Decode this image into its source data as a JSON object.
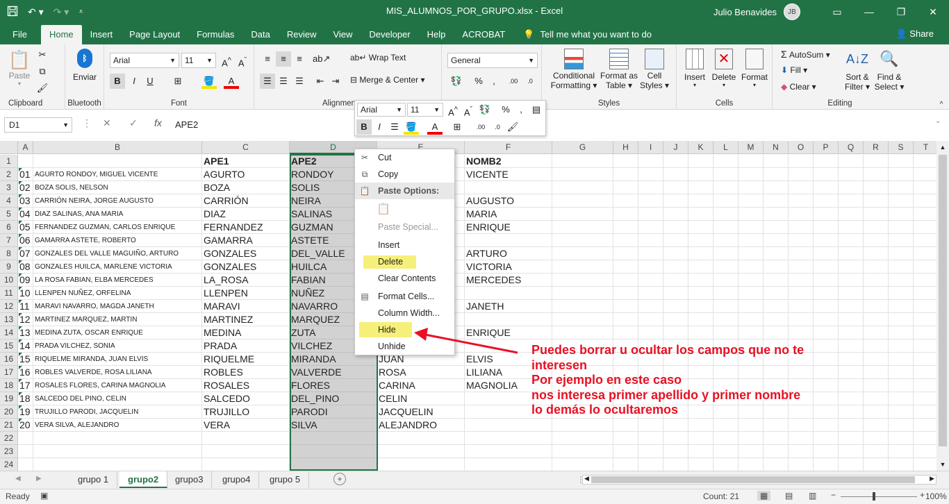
{
  "title_bar": {
    "title": "MIS_ALUMNOS_POR_GRUPO.xlsx  -  Excel",
    "user": "Julio Benavides",
    "avatar": "JB"
  },
  "menu": {
    "items": [
      "File",
      "Home",
      "Insert",
      "Page Layout",
      "Formulas",
      "Data",
      "Review",
      "View",
      "Developer",
      "Help",
      "ACROBAT"
    ],
    "tell": "Tell me what you want to do",
    "share": "Share"
  },
  "ribbon": {
    "clipboard": {
      "label": "Clipboard",
      "paste": "Paste"
    },
    "bluetooth": {
      "label": "Bluetooth",
      "enviar": "Enviar"
    },
    "font": {
      "label": "Font",
      "family": "Arial",
      "size": "11",
      "bold": "B",
      "italic": "I",
      "underline": "U"
    },
    "alignment": {
      "label": "Alignment",
      "wrap": "Wrap Text",
      "merge": "Merge & Center"
    },
    "number": {
      "format": "General",
      "percent": "%",
      "comma": ","
    },
    "styles": {
      "label": "Styles",
      "conditional_1": "Conditional",
      "conditional_2": "Formatting",
      "format_table_1": "Format as",
      "format_table_2": "Table",
      "cell_styles_1": "Cell",
      "cell_styles_2": "Styles"
    },
    "cells": {
      "label": "Cells",
      "insert": "Insert",
      "delete": "Delete",
      "format": "Format"
    },
    "editing": {
      "label": "Editing",
      "autosum": "AutoSum",
      "fill": "Fill",
      "clear": "Clear",
      "sort_1": "Sort &",
      "sort_2": "Filter",
      "find_1": "Find &",
      "find_2": "Select"
    }
  },
  "formula_bar": {
    "name_box": "D1",
    "fx": "fx",
    "value": "APE2"
  },
  "columns": [
    "A",
    "B",
    "C",
    "D",
    "E",
    "F",
    "G",
    "H",
    "I",
    "J",
    "K",
    "L",
    "M",
    "N",
    "O",
    "P",
    "Q",
    "R",
    "S",
    "T"
  ],
  "headers": {
    "c": "APE1",
    "d": "APE2",
    "f": "NOMB2"
  },
  "rows": [
    {
      "a": "01",
      "b": "AGURTO RONDOY, MIGUEL VICENTE",
      "c": "AGURTO",
      "d": "RONDOY",
      "e": "",
      "f": "VICENTE"
    },
    {
      "a": "02",
      "b": "BOZA SOLIS, NELSON",
      "c": "BOZA",
      "d": "SOLIS",
      "e": "",
      "f": ""
    },
    {
      "a": "03",
      "b": "CARRIÓN NEIRA, JORGE AUGUSTO",
      "c": "CARRIÓN",
      "d": "NEIRA",
      "e": "",
      "f": "AUGUSTO"
    },
    {
      "a": "04",
      "b": "DIAZ SALINAS, ANA MARIA",
      "c": "DIAZ",
      "d": "SALINAS",
      "e": "",
      "f": "MARIA"
    },
    {
      "a": "05",
      "b": "FERNANDEZ GUZMAN, CARLOS ENRIQUE",
      "c": "FERNANDEZ",
      "d": "GUZMAN",
      "e": "",
      "f": "ENRIQUE"
    },
    {
      "a": "06",
      "b": "GAMARRA ASTETE, ROBERTO",
      "c": "GAMARRA",
      "d": "ASTETE",
      "e": "",
      "f": ""
    },
    {
      "a": "07",
      "b": "GONZALES DEL VALLE MAGUIÑO, ARTURO",
      "c": "GONZALES",
      "d": "DEL_VALLE",
      "e": "",
      "f": "ARTURO"
    },
    {
      "a": "08",
      "b": "GONZALES HUILCA, MARLENE VICTORIA",
      "c": "GONZALES",
      "d": "HUILCA",
      "e": "",
      "f": "VICTORIA"
    },
    {
      "a": "09",
      "b": "LA ROSA FABIAN, ELBA MERCEDES",
      "c": "LA_ROSA",
      "d": "FABIAN",
      "e": "",
      "f": "MERCEDES"
    },
    {
      "a": "10",
      "b": "LLENPEN NUÑEZ, ORFELINA",
      "c": "LLENPEN",
      "d": "NUÑEZ",
      "e": "",
      "f": ""
    },
    {
      "a": "11",
      "b": "MARAVI NAVARRO, MAGDA JANETH",
      "c": "MARAVI",
      "d": "NAVARRO",
      "e": "",
      "f": "JANETH"
    },
    {
      "a": "12",
      "b": "MARTINEZ MARQUEZ, MARTIN",
      "c": "MARTINEZ",
      "d": "MARQUEZ",
      "e": "",
      "f": ""
    },
    {
      "a": "13",
      "b": "MEDINA ZUTA, OSCAR ENRIQUE",
      "c": "MEDINA",
      "d": "ZUTA",
      "e": "",
      "f": "ENRIQUE"
    },
    {
      "a": "14",
      "b": "PRADA VILCHEZ, SONIA",
      "c": "PRADA",
      "d": "VILCHEZ",
      "e": "",
      "f": ""
    },
    {
      "a": "15",
      "b": "RIQUELME MIRANDA, JUAN ELVIS",
      "c": "RIQUELME",
      "d": "MIRANDA",
      "e": "JUAN",
      "f": "ELVIS"
    },
    {
      "a": "16",
      "b": "ROBLES VALVERDE, ROSA LILIANA",
      "c": "ROBLES",
      "d": "VALVERDE",
      "e": "ROSA",
      "f": "LILIANA"
    },
    {
      "a": "17",
      "b": "ROSALES FLORES, CARINA MAGNOLIA",
      "c": "ROSALES",
      "d": "FLORES",
      "e": "CARINA",
      "f": "MAGNOLIA"
    },
    {
      "a": "18",
      "b": "SALCEDO DEL PINO, CELIN",
      "c": "SALCEDO",
      "d": "DEL_PINO",
      "e": "CELIN",
      "f": ""
    },
    {
      "a": "19",
      "b": "TRUJILLO PARODI, JACQUELIN",
      "c": "TRUJILLO",
      "d": "PARODI",
      "e": "JACQUELIN",
      "f": ""
    },
    {
      "a": "20",
      "b": "VERA SILVA, ALEJANDRO",
      "c": "VERA",
      "d": "SILVA",
      "e": "ALEJANDRO",
      "f": ""
    }
  ],
  "context_menu": {
    "cut": "Cut",
    "copy": "Copy",
    "paste_options": "Paste Options:",
    "paste_special": "Paste Special...",
    "insert": "Insert",
    "delete": "Delete",
    "clear_contents": "Clear Contents",
    "format_cells": "Format Cells...",
    "column_width": "Column Width...",
    "hide": "Hide",
    "unhide": "Unhide"
  },
  "mini_toolbar": {
    "font": "Arial",
    "size": "11",
    "bold": "B",
    "italic": "I",
    "percent": "%",
    "comma": ","
  },
  "annotation": [
    "Puedes borrar u ocultar los campos que no te",
    "interesen",
    "Por ejemplo en este caso",
    "nos interesa primer apellido y primer nombre",
    "lo demás lo ocultaremos"
  ],
  "sheets": [
    "grupo 1",
    "grupo2",
    "grupo3",
    "grupo4",
    "grupo 5"
  ],
  "active_sheet": "grupo2",
  "status": {
    "ready": "Ready",
    "count": "Count: 21",
    "zoom": "100%"
  },
  "colors": {
    "excel_green": "#217346",
    "highlight": "#f6f07a",
    "annotation": "#e81123"
  }
}
